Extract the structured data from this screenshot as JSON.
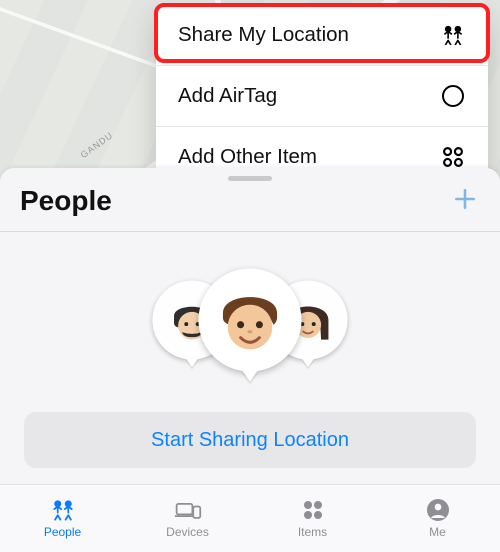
{
  "map": {
    "street_label": "GANDU"
  },
  "popover": {
    "items": [
      {
        "label": "Share My Location",
        "icon": "people-icon"
      },
      {
        "label": "Add AirTag",
        "icon": "circle-icon"
      },
      {
        "label": "Add Other Item",
        "icon": "grid-dots-icon"
      }
    ],
    "highlighted_index": 0
  },
  "panel": {
    "title": "People",
    "share_button": "Start Sharing Location"
  },
  "tabs": [
    {
      "label": "People",
      "icon": "people-icon",
      "active": true
    },
    {
      "label": "Devices",
      "icon": "devices-icon",
      "active": false
    },
    {
      "label": "Items",
      "icon": "grid-dots-icon",
      "active": false
    },
    {
      "label": "Me",
      "icon": "person-icon",
      "active": false
    }
  ],
  "colors": {
    "accent": "#0a7aff",
    "destructive_ring": "#ff1f1f"
  }
}
